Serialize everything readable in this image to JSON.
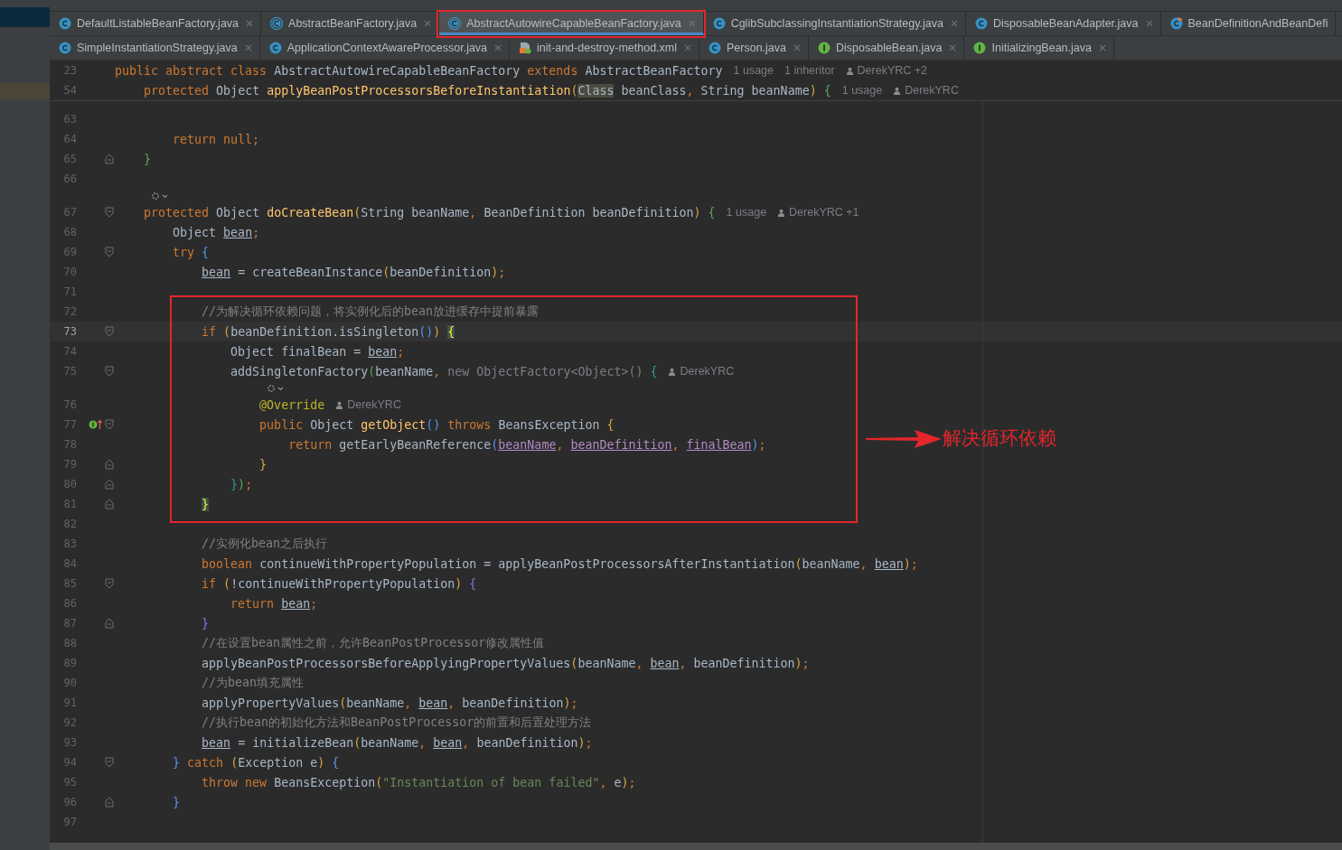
{
  "tab_rows": [
    {
      "tabs": [
        {
          "label": "DefaultListableBeanFactory.java",
          "kind": "class",
          "selected": false,
          "closable": true
        },
        {
          "label": "AbstractBeanFactory.java",
          "kind": "abstract",
          "selected": false,
          "closable": true
        },
        {
          "label": "AbstractAutowireCapableBeanFactory.java",
          "kind": "abstract",
          "selected": true,
          "closable": true
        },
        {
          "label": "CglibSubclassingInstantiationStrategy.java",
          "kind": "class",
          "selected": false,
          "closable": true
        },
        {
          "label": "DisposableBeanAdapter.java",
          "kind": "class",
          "selected": false,
          "closable": true
        },
        {
          "label": "BeanDefinitionAndBeanDefi",
          "kind": "runnable",
          "selected": false,
          "closable": false
        }
      ]
    },
    {
      "tabs": [
        {
          "label": "SimpleInstantiationStrategy.java",
          "kind": "class",
          "selected": false,
          "closable": true
        },
        {
          "label": "ApplicationContextAwareProcessor.java",
          "kind": "class",
          "selected": false,
          "closable": true
        },
        {
          "label": "init-and-destroy-method.xml",
          "kind": "xml",
          "selected": false,
          "closable": true
        },
        {
          "label": "Person.java",
          "kind": "class",
          "selected": false,
          "closable": true
        },
        {
          "label": "DisposableBean.java",
          "kind": "interface",
          "selected": false,
          "closable": true
        },
        {
          "label": "InitializingBean.java",
          "kind": "interface",
          "selected": false,
          "closable": true
        }
      ]
    }
  ],
  "sticky_lines": [
    {
      "no": "23",
      "tokens": [
        {
          "t": "public abstract class",
          "kind": "k"
        },
        {
          "t": " AbstractAutowireCapableBeanFactory",
          "kind": "p"
        },
        {
          "t": " extends",
          "kind": "k"
        },
        {
          "t": " AbstractBeanFactory",
          "kind": "p"
        }
      ],
      "hints": [
        {
          "kind": "usage",
          "text": "1 usage"
        },
        {
          "kind": "usage",
          "text": "1 inheritor"
        },
        {
          "kind": "author",
          "text": "DerekYRC +2"
        }
      ]
    },
    {
      "no": "54",
      "tokens": [
        {
          "t": "    protected",
          "kind": "k"
        },
        {
          "t": " Object",
          "kind": "p"
        },
        {
          "t": " applyBeanPostProcessorsBeforeInstantiation",
          "kind": "f"
        },
        {
          "t": "(",
          "kind": "b1"
        },
        {
          "t": "Class",
          "kind": "hl"
        },
        {
          "t": " beanClass",
          "kind": "p"
        },
        {
          "t": ",",
          "kind": "k"
        },
        {
          "t": " String beanName",
          "kind": "p"
        },
        {
          "t": ")",
          "kind": "b1"
        },
        {
          "t": " {",
          "kind": "b3"
        }
      ],
      "hints": [
        {
          "kind": "usage",
          "text": "1 usage"
        },
        {
          "kind": "author",
          "text": "DerekYRC"
        }
      ]
    }
  ],
  "lines": [
    {
      "kind": "plain",
      "no": "63",
      "current": false
    },
    {
      "kind": "plain",
      "no": "64",
      "current": false,
      "tokens": [
        {
          "t": "        return null;",
          "kind": "k"
        }
      ]
    },
    {
      "kind": "fold_end",
      "no": "65",
      "current": false,
      "tokens": [
        {
          "t": "    }",
          "kind": "b3"
        }
      ]
    },
    {
      "kind": "plain",
      "no": "66",
      "current": false
    },
    {
      "kind": "vision"
    },
    {
      "kind": "fold_start",
      "no": "67",
      "current": false,
      "tokens": [
        {
          "t": "    protected",
          "kind": "k"
        },
        {
          "t": " Object",
          "kind": "p"
        },
        {
          "t": " doCreateBean",
          "kind": "f"
        },
        {
          "t": "(",
          "kind": "b1"
        },
        {
          "t": "String beanName",
          "kind": "p"
        },
        {
          "t": ",",
          "kind": "k"
        },
        {
          "t": " BeanDefinition beanDefinition",
          "kind": "p"
        },
        {
          "t": ")",
          "kind": "b1"
        },
        {
          "t": " {",
          "kind": "b3"
        }
      ],
      "hints": [
        {
          "kind": "usage",
          "text": "1 usage"
        },
        {
          "kind": "author",
          "text": "DerekYRC +1"
        }
      ]
    },
    {
      "kind": "plain",
      "no": "68",
      "current": false,
      "tokens": [
        {
          "t": "        Object",
          "kind": "p"
        },
        {
          "t": " bean",
          "kind": "u"
        },
        {
          "t": ";",
          "kind": "k"
        }
      ]
    },
    {
      "kind": "fold_start",
      "no": "69",
      "current": false,
      "tokens": [
        {
          "t": "        try",
          "kind": "k"
        },
        {
          "t": " {",
          "kind": "b2"
        }
      ]
    },
    {
      "kind": "plain",
      "no": "70",
      "current": false,
      "tokens": [
        {
          "t": "            bean",
          "kind": "u"
        },
        {
          "t": " = createBeanInstance",
          "kind": "p"
        },
        {
          "t": "(",
          "kind": "b1"
        },
        {
          "t": "beanDefinition",
          "kind": "p"
        },
        {
          "t": ")",
          "kind": "b1"
        },
        {
          "t": ";",
          "kind": "k"
        }
      ]
    },
    {
      "kind": "plain",
      "no": "71",
      "current": false
    },
    {
      "kind": "plain",
      "no": "72",
      "current": false,
      "tokens": [
        {
          "t": "            //为解决循环依赖问题，将实例化后的bean放进缓存中提前暴露",
          "kind": "c"
        }
      ]
    },
    {
      "kind": "fold_start",
      "no": "73",
      "current": true,
      "tokens": [
        {
          "t": "            if",
          "kind": "k"
        },
        {
          "t": " (",
          "kind": "b1"
        },
        {
          "t": "beanDefinition.isSingleton",
          "kind": "p"
        },
        {
          "t": "()",
          "kind": "b2"
        },
        {
          "t": ")",
          "kind": "b1"
        },
        {
          "t": " {",
          "kind": "bm"
        }
      ]
    },
    {
      "kind": "plain",
      "no": "74",
      "current": false,
      "tokens": [
        {
          "t": "                Object finalBean =",
          "kind": "p"
        },
        {
          "t": " bean",
          "kind": "u"
        },
        {
          "t": ";",
          "kind": "k"
        }
      ]
    },
    {
      "kind": "fold_start",
      "no": "75",
      "current": false,
      "tokens": [
        {
          "t": "                addSingletonFactory",
          "kind": "p"
        },
        {
          "t": "(",
          "kind": "b3"
        },
        {
          "t": "beanName",
          "kind": "p"
        },
        {
          "t": ",",
          "kind": "k"
        },
        {
          "t": " new ObjectFactory<Object>()",
          "kind": "d"
        },
        {
          "t": " {",
          "kind": "b4"
        }
      ],
      "hints": [
        {
          "kind": "author",
          "text": "DerekYRC"
        }
      ]
    },
    {
      "kind": "vision"
    },
    {
      "kind": "plain",
      "no": "76",
      "current": false,
      "tokens": [
        {
          "t": "                    @Override",
          "kind": "a"
        }
      ],
      "hints": [
        {
          "kind": "author",
          "text": "DerekYRC"
        }
      ]
    },
    {
      "kind": "fold_start",
      "no": "77",
      "current": false,
      "implements_marker": true,
      "tokens": [
        {
          "t": "                    public",
          "kind": "k"
        },
        {
          "t": " Object",
          "kind": "p"
        },
        {
          "t": " getObject",
          "kind": "f"
        },
        {
          "t": "()",
          "kind": "b2"
        },
        {
          "t": " throws",
          "kind": "k"
        },
        {
          "t": " BeansException",
          "kind": "p"
        },
        {
          "t": " {",
          "kind": "b1"
        }
      ]
    },
    {
      "kind": "plain",
      "no": "78",
      "current": false,
      "tokens": [
        {
          "t": "                        return",
          "kind": "k"
        },
        {
          "t": " getEarlyBeanReference",
          "kind": "p"
        },
        {
          "t": "(",
          "kind": "b2"
        },
        {
          "t": "beanName",
          "kind": "v"
        },
        {
          "t": ",",
          "kind": "k"
        },
        {
          "t": " beanDefinition",
          "kind": "v"
        },
        {
          "t": ",",
          "kind": "k"
        },
        {
          "t": " finalBean",
          "kind": "v"
        },
        {
          "t": ")",
          "kind": "b2"
        },
        {
          "t": ";",
          "kind": "k"
        }
      ]
    },
    {
      "kind": "fold_end",
      "no": "79",
      "current": false,
      "tokens": [
        {
          "t": "                    }",
          "kind": "b1"
        }
      ]
    },
    {
      "kind": "fold_end",
      "no": "80",
      "current": false,
      "tokens": [
        {
          "t": "                }",
          "kind": "b4"
        },
        {
          "t": ")",
          "kind": "b3"
        },
        {
          "t": ";",
          "kind": "k"
        }
      ]
    },
    {
      "kind": "fold_end",
      "no": "81",
      "current": false,
      "tokens": [
        {
          "t": "            }",
          "kind": "bm"
        }
      ]
    },
    {
      "kind": "plain",
      "no": "82",
      "current": false
    },
    {
      "kind": "plain",
      "no": "83",
      "current": false,
      "tokens": [
        {
          "t": "            //实例化bean之后执行",
          "kind": "c"
        }
      ]
    },
    {
      "kind": "plain",
      "no": "84",
      "current": false,
      "tokens": [
        {
          "t": "            boolean",
          "kind": "k"
        },
        {
          "t": " continueWithPropertyPopulation = applyBeanPostProcessorsAfterInstantiation",
          "kind": "p"
        },
        {
          "t": "(",
          "kind": "b1"
        },
        {
          "t": "beanName",
          "kind": "p"
        },
        {
          "t": ",",
          "kind": "k"
        },
        {
          "t": " bean",
          "kind": "u"
        },
        {
          "t": ")",
          "kind": "b1"
        },
        {
          "t": ";",
          "kind": "k"
        }
      ]
    },
    {
      "kind": "fold_start",
      "no": "85",
      "current": false,
      "tokens": [
        {
          "t": "            if",
          "kind": "k"
        },
        {
          "t": " (",
          "kind": "b1"
        },
        {
          "t": "!continueWithPropertyPopulation",
          "kind": "p"
        },
        {
          "t": ")",
          "kind": "b1"
        },
        {
          "t": " {",
          "kind": "b5"
        }
      ]
    },
    {
      "kind": "plain",
      "no": "86",
      "current": false,
      "tokens": [
        {
          "t": "                return",
          "kind": "k"
        },
        {
          "t": " bean",
          "kind": "u"
        },
        {
          "t": ";",
          "kind": "k"
        }
      ]
    },
    {
      "kind": "fold_end",
      "no": "87",
      "current": false,
      "tokens": [
        {
          "t": "            }",
          "kind": "b5"
        }
      ]
    },
    {
      "kind": "plain",
      "no": "88",
      "current": false,
      "tokens": [
        {
          "t": "            //在设置bean属性之前，允许BeanPostProcessor修改属性值",
          "kind": "c"
        }
      ]
    },
    {
      "kind": "plain",
      "no": "89",
      "current": false,
      "tokens": [
        {
          "t": "            applyBeanPostProcessorsBeforeApplyingPropertyValues",
          "kind": "p"
        },
        {
          "t": "(",
          "kind": "b1"
        },
        {
          "t": "beanName",
          "kind": "p"
        },
        {
          "t": ",",
          "kind": "k"
        },
        {
          "t": " bean",
          "kind": "u"
        },
        {
          "t": ",",
          "kind": "k"
        },
        {
          "t": " beanDefinition",
          "kind": "p"
        },
        {
          "t": ")",
          "kind": "b1"
        },
        {
          "t": ";",
          "kind": "k"
        }
      ]
    },
    {
      "kind": "plain",
      "no": "90",
      "current": false,
      "tokens": [
        {
          "t": "            //为bean填充属性",
          "kind": "c"
        }
      ]
    },
    {
      "kind": "plain",
      "no": "91",
      "current": false,
      "tokens": [
        {
          "t": "            applyPropertyValues",
          "kind": "p"
        },
        {
          "t": "(",
          "kind": "b1"
        },
        {
          "t": "beanName",
          "kind": "p"
        },
        {
          "t": ",",
          "kind": "k"
        },
        {
          "t": " bean",
          "kind": "u"
        },
        {
          "t": ",",
          "kind": "k"
        },
        {
          "t": " beanDefinition",
          "kind": "p"
        },
        {
          "t": ")",
          "kind": "b1"
        },
        {
          "t": ";",
          "kind": "k"
        }
      ]
    },
    {
      "kind": "plain",
      "no": "92",
      "current": false,
      "tokens": [
        {
          "t": "            //执行bean的初始化方法和BeanPostProcessor的前置和后置处理方法",
          "kind": "c"
        }
      ]
    },
    {
      "kind": "plain",
      "no": "93",
      "current": false,
      "tokens": [
        {
          "t": "            bean",
          "kind": "u"
        },
        {
          "t": " = initializeBean",
          "kind": "p"
        },
        {
          "t": "(",
          "kind": "b1"
        },
        {
          "t": "beanName",
          "kind": "p"
        },
        {
          "t": ",",
          "kind": "k"
        },
        {
          "t": " bean",
          "kind": "u"
        },
        {
          "t": ",",
          "kind": "k"
        },
        {
          "t": " beanDefinition",
          "kind": "p"
        },
        {
          "t": ")",
          "kind": "b1"
        },
        {
          "t": ";",
          "kind": "k"
        }
      ]
    },
    {
      "kind": "fold_start",
      "no": "94",
      "current": false,
      "tokens": [
        {
          "t": "        }",
          "kind": "b2"
        },
        {
          "t": " catch",
          "kind": "k"
        },
        {
          "t": " (",
          "kind": "b1"
        },
        {
          "t": "Exception e",
          "kind": "p"
        },
        {
          "t": ")",
          "kind": "b1"
        },
        {
          "t": " {",
          "kind": "b2"
        }
      ]
    },
    {
      "kind": "plain",
      "no": "95",
      "current": false,
      "tokens": [
        {
          "t": "            throw new",
          "kind": "k"
        },
        {
          "t": " BeansException",
          "kind": "p"
        },
        {
          "t": "(",
          "kind": "b1"
        },
        {
          "t": "\"Instantiation of bean failed\"",
          "kind": "s"
        },
        {
          "t": ",",
          "kind": "k"
        },
        {
          "t": " e",
          "kind": "p"
        },
        {
          "t": ")",
          "kind": "b1"
        },
        {
          "t": ";",
          "kind": "k"
        }
      ]
    },
    {
      "kind": "fold_end",
      "no": "96",
      "current": false,
      "tokens": [
        {
          "t": "        }",
          "kind": "b2"
        }
      ]
    },
    {
      "kind": "plain",
      "no": "97",
      "current": false
    }
  ],
  "annotation": {
    "note": "解决循环依赖"
  }
}
